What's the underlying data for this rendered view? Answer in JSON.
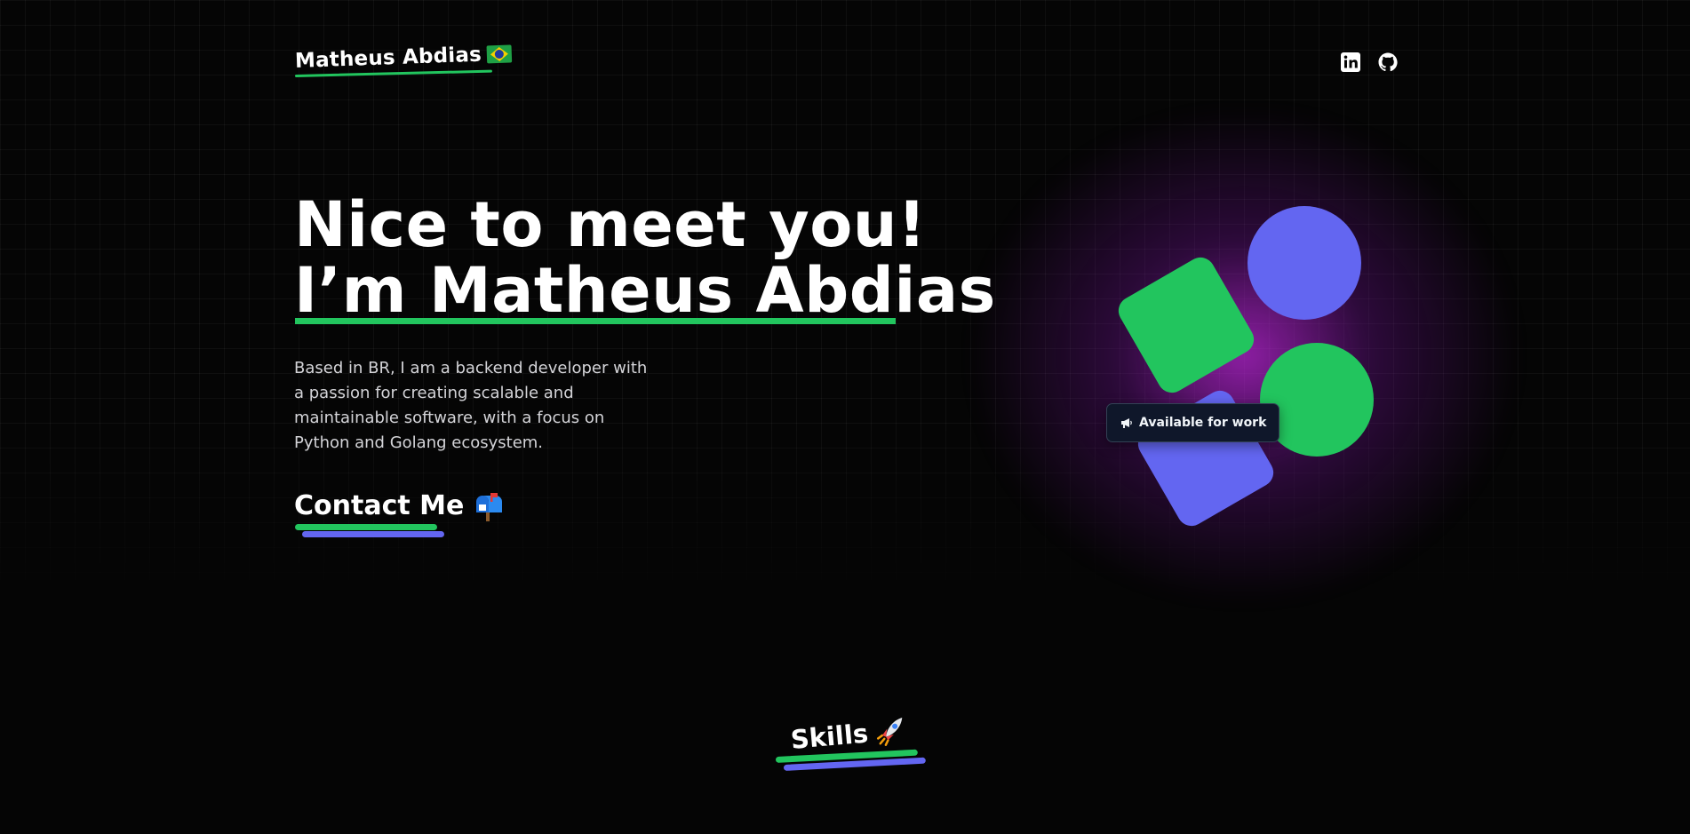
{
  "header": {
    "brand_name": "Matheus Abdias",
    "brand_flag_icon": "brazil-flag-icon",
    "social_links": [
      {
        "name": "linkedin",
        "icon": "linkedin-icon"
      },
      {
        "name": "github",
        "icon": "github-icon"
      }
    ]
  },
  "hero": {
    "title_line1": "Nice to meet you!",
    "title_line2": "I’m Matheus Abdias",
    "description": "Based in BR, I am a backend developer with a passion for creating scalable and maintainable software, with a focus on Python and Golang ecosystem.",
    "contact_label": "Contact Me",
    "contact_icon": "mailbox-icon",
    "status_badge": "Available for work",
    "status_icon": "megaphone-icon"
  },
  "skills": {
    "title": "Skills",
    "icon": "rocket-icon"
  },
  "colors": {
    "background": "#050505",
    "accent_green": "#22c55e",
    "accent_purple": "#6366f1",
    "glow_magenta": "#be28dc",
    "text_muted": "#d4d4d8",
    "badge_bg": "#0f172a"
  }
}
